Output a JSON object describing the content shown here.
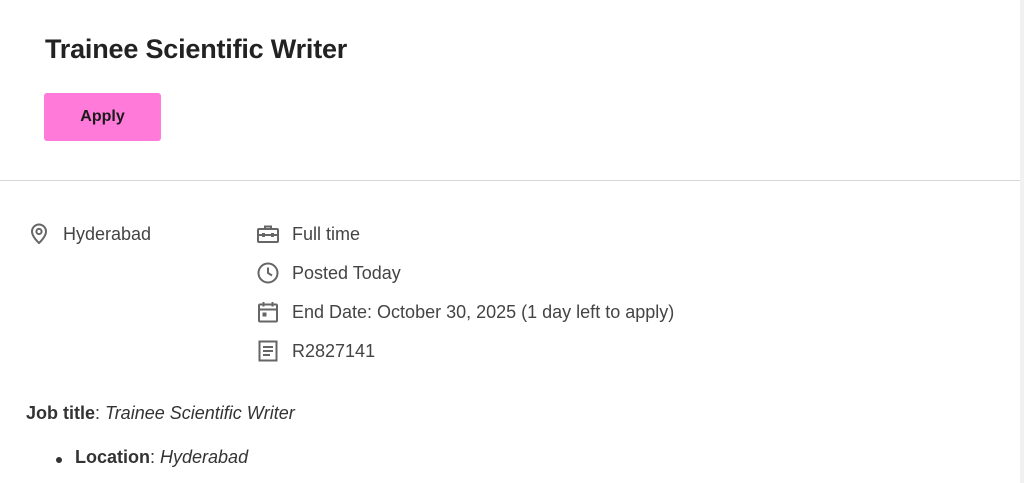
{
  "header": {
    "title": "Trainee Scientific Writer",
    "apply_label": "Apply"
  },
  "details": {
    "location": "Hyderabad",
    "employment_type": "Full time",
    "posted": "Posted Today",
    "end_date": "End Date: October 30, 2025 (1 day left to apply)",
    "requisition_id": "R2827141"
  },
  "description": {
    "job_title_label": "Job title",
    "job_title_value": "Trainee Scientific Writer",
    "location_label": "Location",
    "location_value": "Hyderabad"
  },
  "icons": {
    "location": "location-pin-icon",
    "employment_type": "briefcase-icon",
    "posted": "clock-icon",
    "end_date": "calendar-icon",
    "requisition_id": "document-icon"
  },
  "colors": {
    "apply_button": "#ff7ad9",
    "icon": "#666666",
    "divider": "#d6d6d6"
  }
}
